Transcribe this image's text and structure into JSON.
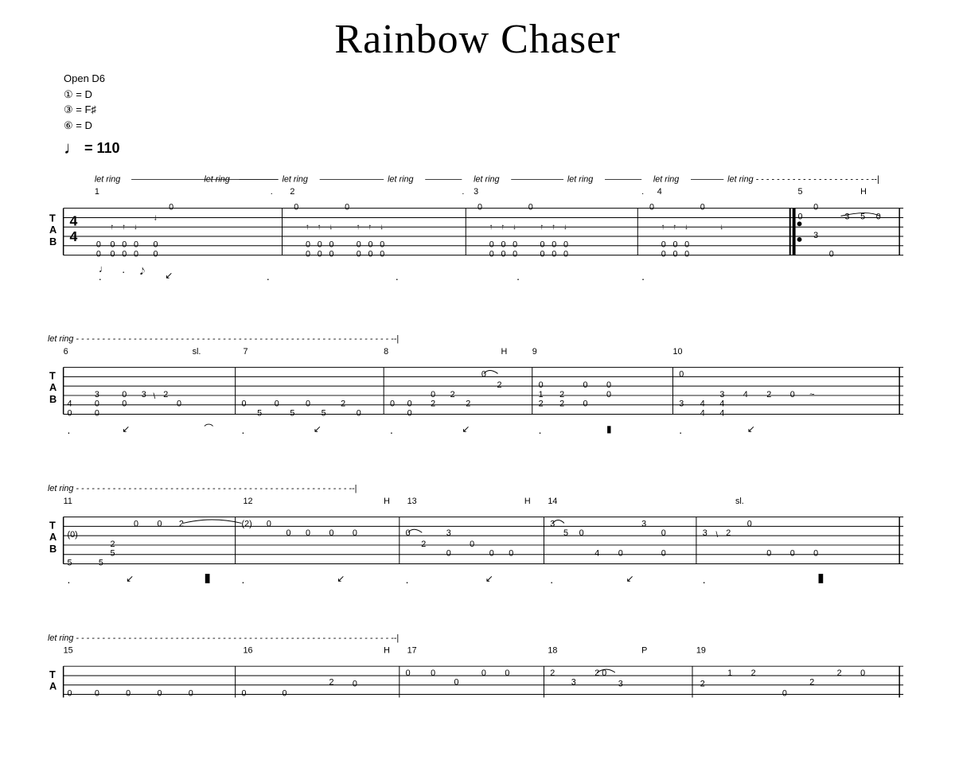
{
  "title": "Rainbow Chaser",
  "tuning": {
    "label": "Open D6",
    "string1": "① = D",
    "string3": "③ = F♯",
    "string6": "⑥ = D"
  },
  "tempo": {
    "symbol": "♩",
    "value": "= 110"
  },
  "systems": [
    {
      "id": 1,
      "letRing": "let ring --------------------------------------------------------------------------------------------------|",
      "measures": "1 . let ring . let ring 2 . let ring . let ring 3 . let ring . let ring 4 . let ring 5 H",
      "timeSignature": "4/4"
    },
    {
      "id": 2,
      "letRing": "let ring ------------------------------------------------------------------------------------------------------------------|",
      "measures": "6 sl. 7 8 H 9 10"
    },
    {
      "id": 3,
      "letRing": "let ring --------------------------------------------------------------------------------------------------------|",
      "measures": "11 12 H 13 H 14 sl."
    },
    {
      "id": 4,
      "letRing": "let ring --------------------------------------------------------------------------------------------------|",
      "measures": "15 16 H 17 18 P 19"
    }
  ]
}
